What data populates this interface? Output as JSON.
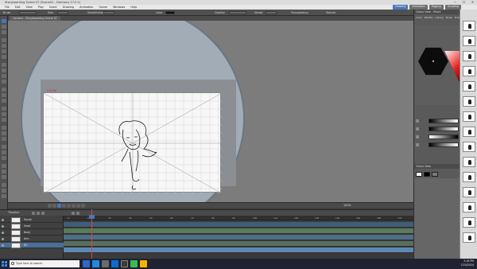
{
  "window": {
    "title": "Storyboarding Scene 07 (Scene01 - Harmony 17.0.1)",
    "controls": [
      "─",
      "☐",
      "✕"
    ]
  },
  "menu": [
    "File",
    "Edit",
    "View",
    "Play",
    "Insert",
    "Drawing",
    "Animation",
    "Scene",
    "Windows",
    "Help"
  ],
  "workspace_tabs": [
    {
      "label": "Drawing",
      "active": true
    },
    {
      "label": "Animation",
      "active": false
    },
    {
      "label": "Rigging",
      "active": false
    },
    {
      "label": "Scripting",
      "active": false
    }
  ],
  "tool_properties": {
    "brush_label": "Brush",
    "size_label": "Size",
    "size_value": "5",
    "smoothness_label": "Smoothness",
    "smoothness_value": "3",
    "color_label": "Color",
    "opacity_label": "Opacity",
    "stroke_label": "Stroke",
    "transparency_label": "Transparency",
    "texture_label": "Texture"
  },
  "view": {
    "tab_label": "Camera - Storyboarding Scene 07",
    "paper_label": "1-12 fld",
    "zoom": "100%"
  },
  "timeline": {
    "tab_label": "Timeline",
    "layers": [
      {
        "name": "Mouth"
      },
      {
        "name": "Head"
      },
      {
        "name": "Body"
      },
      {
        "name": "Arm"
      },
      {
        "name": "BG"
      }
    ],
    "ruler_ticks": [
      "10",
      "20",
      "30",
      "40",
      "50",
      "60",
      "70",
      "80",
      "90",
      "100",
      "110",
      "120",
      "130",
      "140",
      "150",
      "160",
      "170"
    ]
  },
  "right_panel": {
    "title": "Colour View - Pencil",
    "tabs": [
      "Color",
      "Palette",
      "Library",
      "Node",
      "Properties"
    ],
    "color_view_title": "Colour View",
    "swatches": [
      "#ffffff",
      "#000000",
      "#7a7a7a"
    ]
  },
  "colors": {
    "accent": "#4a76b8",
    "paper": "#f7f7f7",
    "camera_circle": "#a2acb6",
    "stroke_red": "#e82020"
  },
  "taskbar": {
    "search_placeholder": "Type here to search",
    "time": "3:16 PM",
    "date": "7/25/2024",
    "apps": [
      "file-explorer-icon",
      "edge-icon",
      "store-icon",
      "mail-icon",
      "harmony-icon",
      "chrome-icon",
      "folder-icon"
    ]
  }
}
